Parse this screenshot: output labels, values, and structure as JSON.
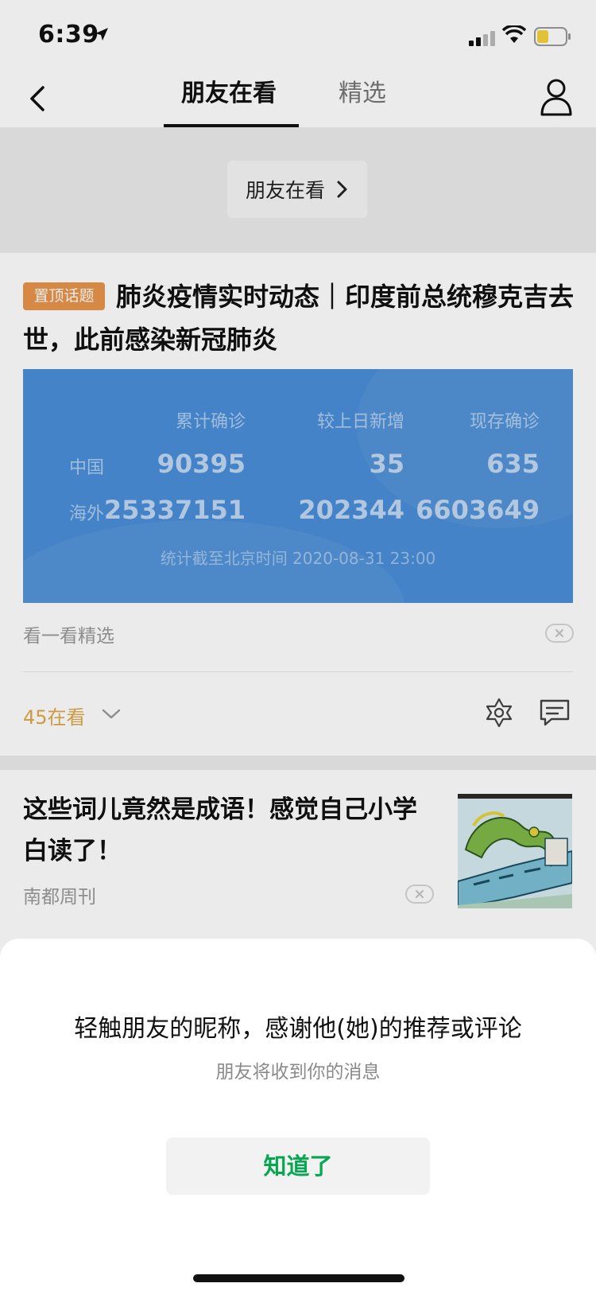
{
  "status_bar": {
    "time": "6:39",
    "battery_color": "#f5d33b"
  },
  "header": {
    "tabs": [
      {
        "label": "朋友在看",
        "active": true
      },
      {
        "label": "精选",
        "active": false
      }
    ],
    "icons": {
      "back": "chevron-left-icon",
      "profile": "person-icon"
    }
  },
  "friends_pill": {
    "label": "朋友在看"
  },
  "card1": {
    "tag": "置顶话题",
    "title": "肺炎疫情实时动态｜印度前总统穆克吉去世，此前感染新冠肺炎",
    "banner": {
      "headers": [
        "累计确诊",
        "较上日新增",
        "现存确诊"
      ],
      "rows": [
        {
          "region": "中国",
          "values": [
            "90395",
            "35",
            "635"
          ]
        },
        {
          "region": "海外",
          "values": [
            "25337151",
            "202344",
            "6603649"
          ]
        }
      ],
      "footer": "统计截至北京时间 2020-08-31 23:00"
    },
    "source": "看一看精选",
    "watching": "45在看",
    "accent_color": "#e0a84a"
  },
  "card2": {
    "title": "这些词儿竟然是成语！感觉自己小学白读了！",
    "source": "南都周刊"
  },
  "sheet": {
    "title": "轻触朋友的昵称，感谢他(她)的推荐或评论",
    "subtitle": "朋友将收到你的消息",
    "button": "知道了",
    "button_color": "#07a651"
  }
}
